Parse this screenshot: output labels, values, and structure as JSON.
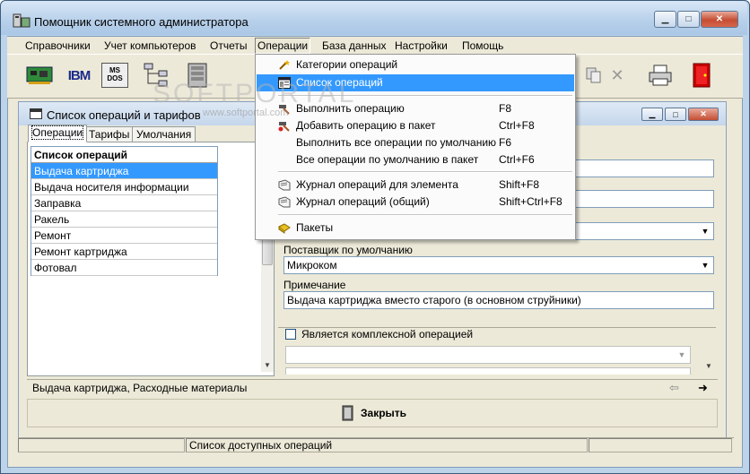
{
  "window": {
    "title": "Помощник системного администратора"
  },
  "menubar": [
    {
      "label": "Справочники"
    },
    {
      "label": "Учет компьютеров"
    },
    {
      "label": "Отчеты"
    },
    {
      "label": "Операции"
    },
    {
      "label": "База данных"
    },
    {
      "label": "Настройки"
    },
    {
      "label": "Помощь"
    }
  ],
  "toolbar": {
    "ibm_label": "IBM",
    "msdos_label": "MS DOS"
  },
  "dropdown": {
    "items": [
      {
        "label": "Категории операций",
        "shortcut": ""
      },
      {
        "label": "Список операций",
        "shortcut": ""
      },
      {
        "label": "Выполнить операцию",
        "shortcut": "F8"
      },
      {
        "label": "Добавить операцию в пакет",
        "shortcut": "Ctrl+F8"
      },
      {
        "label": "Выполнить все операции по умолчанию",
        "shortcut": "F6"
      },
      {
        "label": "Все операции по умолчанию в пакет",
        "shortcut": "Ctrl+F6"
      },
      {
        "label": "Журнал операций для  элемента",
        "shortcut": "Shift+F8"
      },
      {
        "label": "Журнал операций (общий)",
        "shortcut": "Shift+Ctrl+F8"
      },
      {
        "label": "Пакеты",
        "shortcut": ""
      }
    ]
  },
  "watermark": {
    "text": "SOFTPORTAL",
    "url": "www.softportal.com"
  },
  "child": {
    "title": "Список операций и тарифов",
    "tabs": [
      {
        "label": "Операции"
      },
      {
        "label": "Тарифы"
      },
      {
        "label": "Умолчания"
      }
    ],
    "list_header": "Список операций",
    "rows": [
      {
        "label": "Выдача картриджа"
      },
      {
        "label": "Выдача носителя информации"
      },
      {
        "label": "Заправка"
      },
      {
        "label": "Ракель"
      },
      {
        "label": "Ремонт"
      },
      {
        "label": "Ремонт картриджа"
      },
      {
        "label": "Фотовал"
      }
    ],
    "supplier_label": "Поставщик по умолчанию",
    "supplier_value": "Микроком",
    "note_label": "Примечание",
    "note_value": "Выдача картриджа вместо старого (в основном струйники)",
    "complex_label": "Является комплексной операцией",
    "status_text": "Выдача картриджа, Расходные материалы",
    "close_label": "Закрыть"
  },
  "statusbar": {
    "text": "Список доступных операций"
  },
  "colors": {
    "selection": "#3399ff",
    "face": "#ece9d8",
    "frame": "#bcd3ea"
  }
}
